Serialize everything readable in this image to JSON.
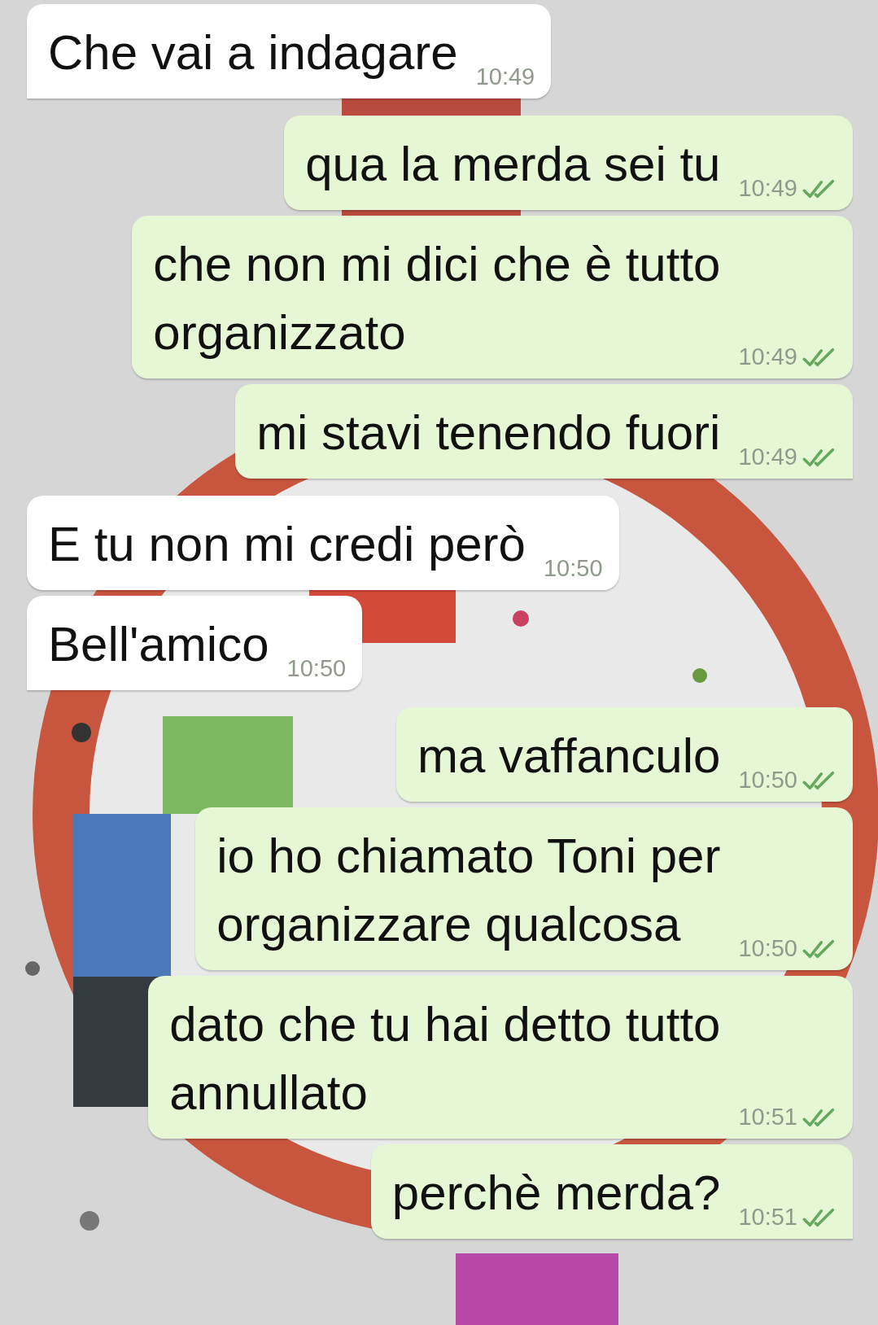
{
  "messages": [
    {
      "kind": "incoming",
      "text": "Che vai a indagare",
      "time": "10:49",
      "tail": true
    },
    {
      "kind": "outgoing",
      "text": "qua la merda sei tu",
      "time": "10:49",
      "tail": false
    },
    {
      "kind": "outgoing",
      "text": "che non mi dici che è tutto\norganizzato",
      "time": "10:49",
      "tail": false
    },
    {
      "kind": "outgoing",
      "text": "mi stavi tenendo fuori",
      "time": "10:49",
      "tail": true
    },
    {
      "kind": "incoming",
      "text": "E tu non mi credi però",
      "time": "10:50",
      "tail": false
    },
    {
      "kind": "incoming",
      "text": "Bell'amico",
      "time": "10:50",
      "tail": true
    },
    {
      "kind": "outgoing",
      "text": "ma vaffanculo",
      "time": "10:50",
      "tail": false
    },
    {
      "kind": "outgoing",
      "text": "io ho chiamato Toni per\norganizzare qualcosa",
      "time": "10:50",
      "tail": false
    },
    {
      "kind": "outgoing",
      "text": "dato che tu hai detto tutto\nannullato",
      "time": "10:51",
      "tail": false
    },
    {
      "kind": "outgoing",
      "text": "perchè merda?",
      "time": "10:51",
      "tail": true
    }
  ]
}
